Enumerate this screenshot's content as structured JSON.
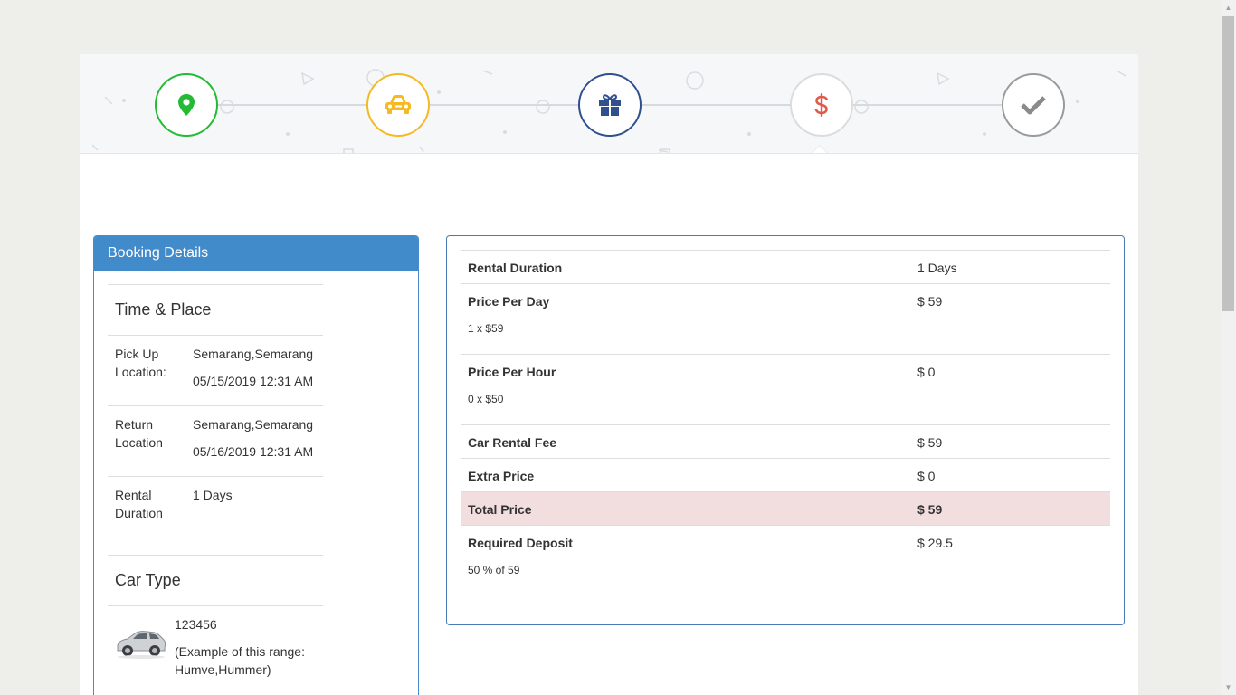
{
  "steps": [
    {
      "name": "location",
      "icon": "map-marker-icon",
      "color": "#22bb33"
    },
    {
      "name": "car",
      "icon": "car-icon",
      "color": "#f5b921"
    },
    {
      "name": "extras",
      "icon": "gift-icon",
      "color": "#2f4f8f"
    },
    {
      "name": "payment",
      "icon": "dollar-icon",
      "color": "#e05b4b"
    },
    {
      "name": "confirm",
      "icon": "check-icon",
      "color": "#8a8a8a"
    }
  ],
  "booking": {
    "title": "Booking Details",
    "time_place_title": "Time & Place",
    "pickup_label": "Pick Up Location:",
    "pickup_place": "Semarang,Semarang",
    "pickup_date": "05/15/2019 12:31 AM",
    "return_label": "Return Location",
    "return_place": "Semarang,Semarang",
    "return_date": "05/16/2019 12:31 AM",
    "duration_label": "Rental Duration",
    "duration_value": "1 Days",
    "car_type_title": "Car Type",
    "car_name": "123456",
    "car_desc": "(Example of this range: Humve,Hummer)"
  },
  "price": {
    "rental_duration_label": "Rental Duration",
    "rental_duration_value": "1 Days",
    "per_day_label": "Price Per Day",
    "per_day_value": "$ 59",
    "per_day_sub": "1 x $59",
    "per_hour_label": "Price Per Hour",
    "per_hour_value": "$ 0",
    "per_hour_sub": "0 x $50",
    "rental_fee_label": "Car Rental Fee",
    "rental_fee_value": "$ 59",
    "extra_label": "Extra Price",
    "extra_value": "$ 0",
    "total_label": "Total Price",
    "total_value": "$ 59",
    "deposit_label": "Required Deposit",
    "deposit_value": "$ 29.5",
    "deposit_sub": "50 % of 59"
  },
  "colors": {
    "panel_header": "#428bca",
    "total_row": "#f2dede"
  }
}
